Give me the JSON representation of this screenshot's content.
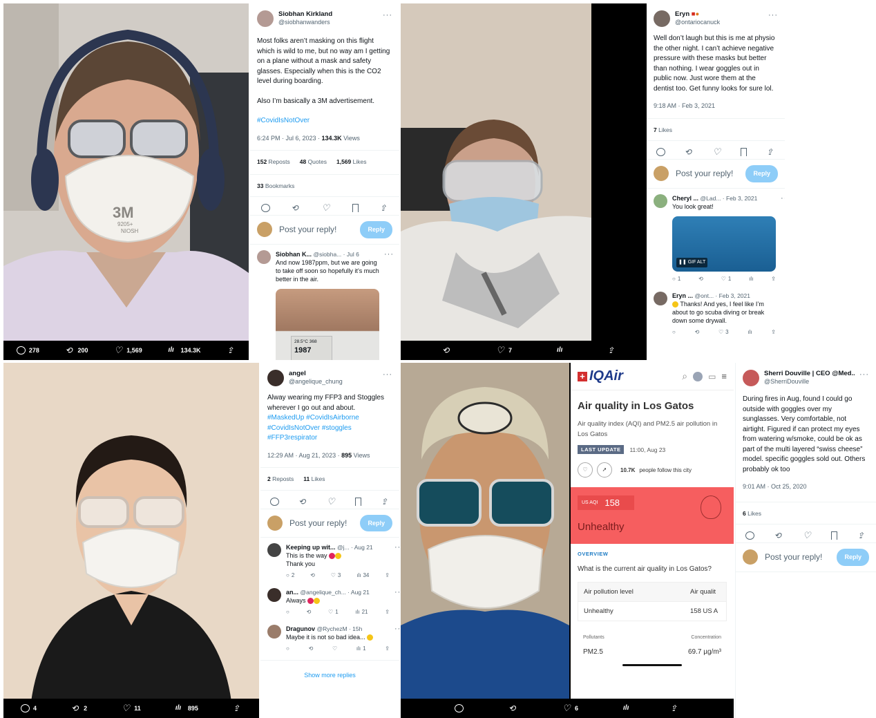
{
  "p1": {
    "bar": {
      "replies": "278",
      "retweets": "200",
      "likes": "1,569",
      "views": "134.3K"
    },
    "tweet": {
      "name": "Siobhan Kirkland",
      "handle": "@siobhanwanders",
      "text1": "Most folks aren’t masking on this flight which is wild to me, but no way am I getting on a plane without a mask and safety glasses. Especially when this is the CO2 level during boarding.",
      "text2": "Also I’m basically a 3M advertisement.",
      "hashtag": "#CovidIsNotOver",
      "time": "6:24 PM · Jul 6, 2023 · ",
      "views": "134.3K",
      "views_label": " Views",
      "reposts": "152",
      "reposts_label": " Reposts",
      "quotes": "48",
      "quotes_label": " Quotes",
      "likes": "1,569",
      "likes_label": " Likes",
      "bookmarks": "33",
      "bookmarks_label": " Bookmarks",
      "reply_placeholder": "Post your reply!",
      "reply_button": "Reply",
      "reply": {
        "name": "Siobhan K...",
        "handle": "@siobha... · Jul 6",
        "text": "And now 1987ppm, but we are going to take off soon so hopefully it’s much better in the air."
      },
      "monitor_temp": "28.5°C  368",
      "monitor_big": "1987"
    },
    "mask_brand": "3M",
    "mask_small": "9205+",
    "mask_niosh": "NIOSH"
  },
  "p2": {
    "bar": {
      "likes": "7"
    },
    "tweet": {
      "name": "Eryn",
      "handle": "@ontariocanuck",
      "text": "Well don’t laugh but this is me at physio the other night. I can’t achieve negative pressure with these masks but better than nothing. I wear goggles out in public now. Just wore them at the dentist too. Get funny looks for sure lol.",
      "time": "9:18 AM · Feb 3, 2021",
      "likes": "7",
      "likes_label": " Likes",
      "reply_placeholder": "Post your reply!",
      "reply_button": "Reply",
      "reply1": {
        "name": "Cheryl ...",
        "handle": "@Lad... · Feb 3, 2021",
        "text": "You look great!",
        "gif": "GIF",
        "alt": "ALT",
        "replies": "1",
        "likes": "1"
      },
      "reply2": {
        "name": "Eryn ...",
        "handle": "@ont... · Feb 3, 2021",
        "text": "Thanks! And yes, I feel like I’m about to go scuba diving or break down some drywall.",
        "likes": "3"
      }
    }
  },
  "p3": {
    "bar": {
      "replies": "4",
      "retweets": "2",
      "likes": "11",
      "views": "895"
    },
    "tweet": {
      "name": "angel",
      "handle": "@angelique_chung",
      "text": "Alway wearing my FFP3 and Stoggles wherever I go out and about.",
      "tags": "#MaskedUp #CovidIsAirborne #CovidIsNotOver #stoggles #FFP3respirator",
      "time": "12:29 AM · Aug 21, 2023 · ",
      "views": "895",
      "views_label": " Views",
      "reposts": "2",
      "reposts_label": " Reposts",
      "likes": "11",
      "likes_label": " Likes",
      "reply_placeholder": "Post your reply!",
      "reply_button": "Reply",
      "r1": {
        "name": "Keeping up wit...",
        "handle": "@j... · Aug 21",
        "text1": "This is the way",
        "text2": "Thank you",
        "replies": "2",
        "likes": "3",
        "views": "34"
      },
      "r2": {
        "name": "an...",
        "handle": "@angelique_ch... · Aug 21",
        "text": "Always",
        "likes": "1",
        "views": "21"
      },
      "r3": {
        "name": "Dragunov",
        "handle": "@RychezM · 15h",
        "text": "Maybe it is not so bad idea...",
        "views": "1"
      },
      "show_more": "Show more replies"
    }
  },
  "p4": {
    "bar": {
      "likes": "6"
    },
    "iqair": {
      "logo": "IQAir",
      "title": "Air quality in Los Gatos",
      "subtitle": "Air quality index (AQI) and PM2.5 air pollution in Los Gatos",
      "last_update_label": "LAST UPDATE",
      "last_update": "11:00, Aug 23",
      "followers": "10.7K",
      "followers_label": " people follow this city",
      "aqi_label": "US AQI",
      "aqi": "158",
      "status": "Unhealthy",
      "overview": "OVERVIEW",
      "question": "What is the current air quality in Los Gatos?",
      "col1": "Air pollution level",
      "col2": "Air qualit",
      "val1": "Unhealthy",
      "val2": "158 US A",
      "pollutants": "Pollutants",
      "concentration": "Concentration",
      "pm": "PM2.5",
      "pm_value": "69.7 µg/m³",
      "accent": "#f65e5f"
    }
  },
  "p5": {
    "tweet": {
      "name": "Sherri Douville | CEO @Med...",
      "handle": "@SherriDouville",
      "text": "During fires in Aug, found I could go outside with goggles over my sunglasses. Very comfortable, not airtight. Figured if can protect my eyes from watering w/smoke, could be ok as part of the multi layered “swiss cheese” model. specific goggles sold out. Others probably ok too",
      "time": "9:01 AM · Oct 25, 2020",
      "likes": "6",
      "likes_label": " Likes",
      "reply_placeholder": "Post your reply!",
      "reply_button": "Reply"
    }
  }
}
